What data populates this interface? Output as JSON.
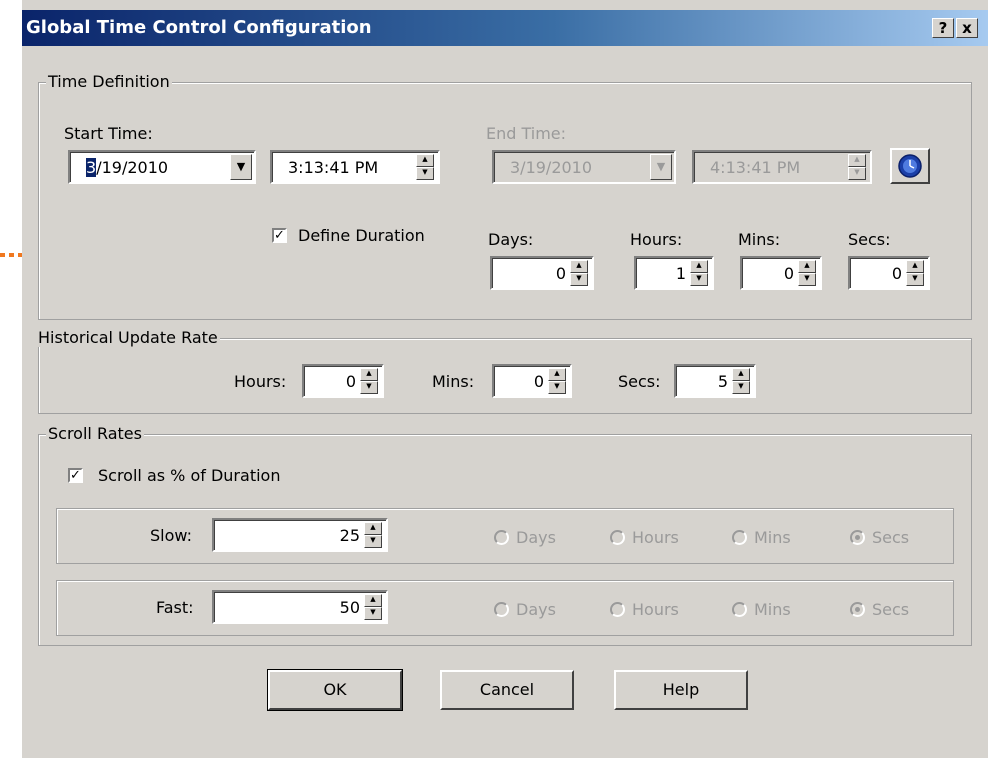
{
  "title": "Global Time Control Configuration",
  "title_buttons": {
    "help": "?",
    "close": "x"
  },
  "time_definition": {
    "legend": "Time Definition",
    "start_label": "Start Time:",
    "start_date_prefix": "3",
    "start_date": "/19/2010",
    "start_time": "3:13:41 PM",
    "end_label": "End Time:",
    "end_date": "3/19/2010",
    "end_time": "4:13:41 PM",
    "define_duration_label": "Define Duration",
    "define_duration_checked": true,
    "days_label": "Days:",
    "days": "0",
    "hours_label": "Hours:",
    "hours": "1",
    "mins_label": "Mins:",
    "mins": "0",
    "secs_label": "Secs:",
    "secs": "0"
  },
  "historical": {
    "legend": "Historical Update Rate",
    "hours_label": "Hours:",
    "hours": "0",
    "mins_label": "Mins:",
    "mins": "0",
    "secs_label": "Secs:",
    "secs": "5"
  },
  "scroll": {
    "legend": "Scroll Rates",
    "percent_label": "Scroll as % of Duration",
    "percent_checked": true,
    "slow_label": "Slow:",
    "slow": "25",
    "fast_label": "Fast:",
    "fast": "50",
    "unit_options": [
      "Days",
      "Hours",
      "Mins",
      "Secs"
    ],
    "selected_unit": "Secs"
  },
  "buttons": {
    "ok": "OK",
    "cancel": "Cancel",
    "help": "Help"
  },
  "colors": {
    "dialog_bg": "#d6d3ce",
    "title_start": "#0a246a",
    "title_end": "#a6caf0",
    "arrow": "#f07820"
  }
}
